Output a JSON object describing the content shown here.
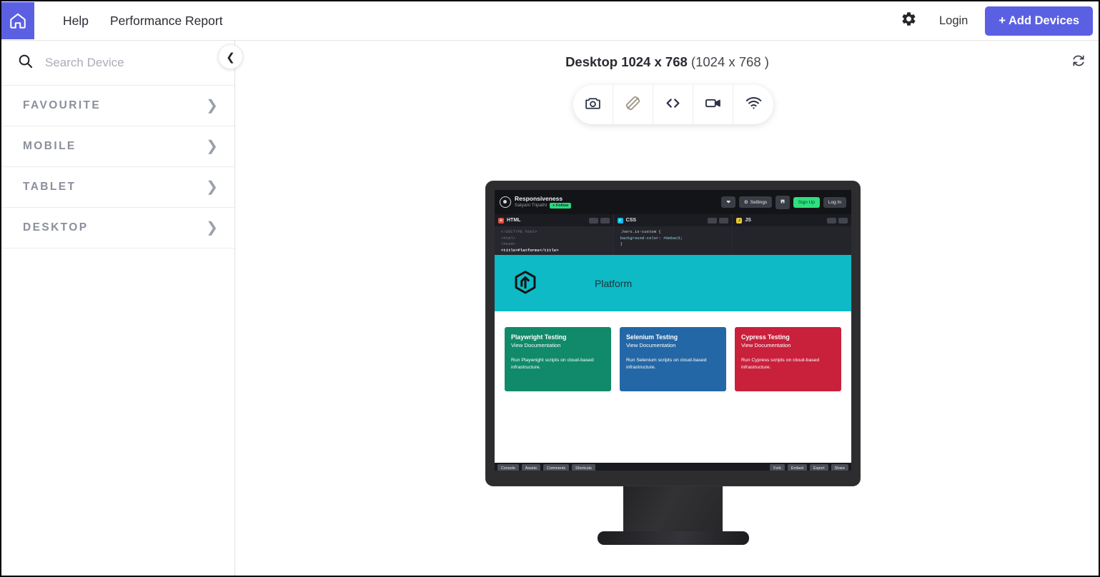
{
  "topbar": {
    "home_icon": "home-icon",
    "links": [
      "Help",
      "Performance Report"
    ],
    "gear_icon": "gear-icon",
    "login_label": "Login",
    "add_devices_label": "+ Add Devices",
    "accent_color": "#5b60e3"
  },
  "sidebar": {
    "search_placeholder": "Search Device",
    "search_value": "",
    "search_icon": "search-icon",
    "collapse_icon": "chevron-left-icon",
    "categories": [
      {
        "label": "FAVOURITE",
        "chevron": "chevron-right-icon"
      },
      {
        "label": "MOBILE",
        "chevron": "chevron-right-icon"
      },
      {
        "label": "TABLET",
        "chevron": "chevron-right-icon"
      },
      {
        "label": "DESKTOP",
        "chevron": "chevron-right-icon"
      }
    ]
  },
  "main": {
    "device_name": "Desktop 1024 x 768",
    "device_resolution": "(1024 x 768 )",
    "refresh_icon": "refresh-icon",
    "tools": [
      {
        "name": "screenshot-icon",
        "label": "camera"
      },
      {
        "name": "rotate-screen-icon",
        "label": "rotate"
      },
      {
        "name": "code-inspector-icon",
        "label": "code"
      },
      {
        "name": "record-video-icon",
        "label": "video"
      },
      {
        "name": "network-throttle-icon",
        "label": "wifi"
      }
    ]
  },
  "preview": {
    "editor": {
      "pen_title": "Responsiveness",
      "pen_author": "Satyam Tripathi",
      "follow_badge": "+ Follow",
      "nav_buttons": [
        {
          "label": "",
          "icon": "heart-icon",
          "style": "dark"
        },
        {
          "label": "Settings",
          "icon": "gear-icon",
          "style": "dark"
        },
        {
          "label": "",
          "icon": "save-icon",
          "style": "dark"
        },
        {
          "label": "Sign Up",
          "icon": "",
          "style": "green"
        },
        {
          "label": "Log In",
          "icon": "",
          "style": "dark"
        }
      ],
      "panels": [
        {
          "name": "HTML",
          "tag": "html",
          "code_lines": [
            "<!DOCTYPE html>",
            "<html>",
            "  <head>",
            "    <title>Platforms</title>"
          ]
        },
        {
          "name": "CSS",
          "tag": "css",
          "code_lines": [
            ".hero.is-custom {",
            "  background-color: #0ebac5;",
            "}"
          ]
        },
        {
          "name": "JS",
          "tag": "js",
          "code_lines": []
        }
      ],
      "footer_left": [
        "Console",
        "Assets",
        "Comments",
        "Shortcuts"
      ],
      "footer_right": [
        "Fork",
        "Embed",
        "Export",
        "Share"
      ]
    },
    "page": {
      "hero_title": "Platform",
      "hero_color": "#0ebac5",
      "hero_logo_icon": "hexagon-arrow-logo-icon",
      "cards": [
        {
          "title": "Playwright Testing",
          "link": "View Documentation",
          "description": "Run Playwright scripts on cloud-based infrastructure.",
          "color": "#108a6a"
        },
        {
          "title": "Selenium Testing",
          "link": "View Documentation",
          "description": "Run Selenium scripts on cloud-based infrastructure.",
          "color": "#2467a6"
        },
        {
          "title": "Cypress Testing",
          "link": "View Documentation",
          "description": "Run Cypress scripts on cloud-based infrastructure.",
          "color": "#c9203c"
        }
      ]
    }
  }
}
